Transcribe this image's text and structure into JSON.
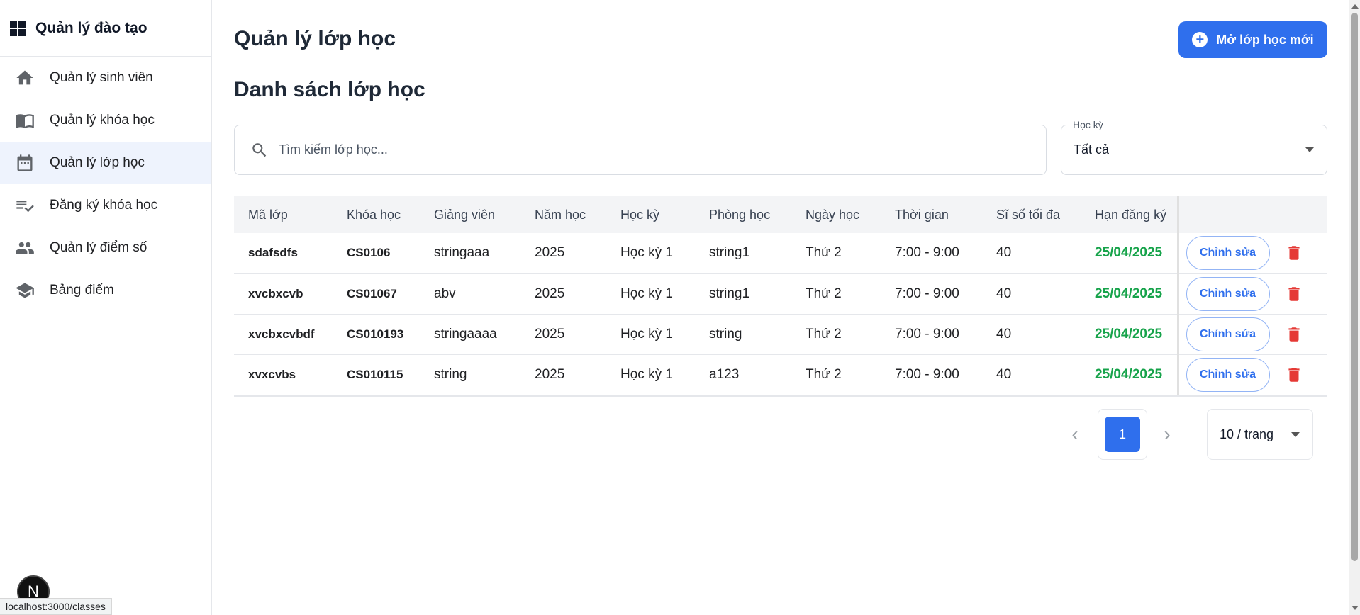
{
  "sidebar": {
    "title": "Quản lý đào tạo",
    "items": [
      {
        "label": "Quản lý sinh viên",
        "icon": "home-icon",
        "active": false
      },
      {
        "label": "Quản lý khóa học",
        "icon": "book-icon",
        "active": false
      },
      {
        "label": "Quản lý lớp học",
        "icon": "calendar-icon",
        "active": true
      },
      {
        "label": "Đăng ký khóa học",
        "icon": "checklist-icon",
        "active": false
      },
      {
        "label": "Quản lý điểm số",
        "icon": "people-icon",
        "active": false
      },
      {
        "label": "Bảng điểm",
        "icon": "school-icon",
        "active": false
      }
    ],
    "avatar_initial": "N"
  },
  "status_url": "localhost:3000/classes",
  "header": {
    "title": "Quản lý lớp học",
    "new_button_label": "Mở lớp học mới"
  },
  "section_title": "Danh sách lớp học",
  "search": {
    "placeholder": "Tìm kiếm lớp học...",
    "value": ""
  },
  "semester_filter": {
    "label": "Học kỳ",
    "value": "Tất cả"
  },
  "table": {
    "columns": [
      "Mã lớp",
      "Khóa học",
      "Giảng viên",
      "Năm học",
      "Học kỳ",
      "Phòng học",
      "Ngày học",
      "Thời gian",
      "Sĩ số tối đa",
      "Hạn đăng ký",
      ""
    ],
    "rows": [
      {
        "code": "sdafsdfs",
        "course": "CS0106",
        "lecturer": "stringaaa",
        "year": "2025",
        "semester": "Học kỳ 1",
        "room": "string1",
        "day": "Thứ 2",
        "time": "7:00 - 9:00",
        "max": "40",
        "deadline": "25/04/2025",
        "edit_label": "Chỉnh sửa"
      },
      {
        "code": "xvcbxcvb",
        "course": "CS01067",
        "lecturer": "abv",
        "year": "2025",
        "semester": "Học kỳ 1",
        "room": "string1",
        "day": "Thứ 2",
        "time": "7:00 - 9:00",
        "max": "40",
        "deadline": "25/04/2025",
        "edit_label": "Chỉnh sửa"
      },
      {
        "code": "xvcbxcvbdf",
        "course": "CS010193",
        "lecturer": "stringaaaa",
        "year": "2025",
        "semester": "Học kỳ 1",
        "room": "string",
        "day": "Thứ 2",
        "time": "7:00 - 9:00",
        "max": "40",
        "deadline": "25/04/2025",
        "edit_label": "Chỉnh sửa"
      },
      {
        "code": "xvxcvbs",
        "course": "CS010115",
        "lecturer": "string",
        "year": "2025",
        "semester": "Học kỳ 1",
        "room": "a123",
        "day": "Thứ 2",
        "time": "7:00 - 9:00",
        "max": "40",
        "deadline": "25/04/2025",
        "edit_label": "Chỉnh sửa"
      }
    ]
  },
  "pagination": {
    "current_page": "1",
    "page_size": "10 / trang"
  },
  "colors": {
    "accent": "#2f6fed",
    "deadline": "#16a34a",
    "delete": "#e53935",
    "active_nav": "#eef3fd"
  }
}
